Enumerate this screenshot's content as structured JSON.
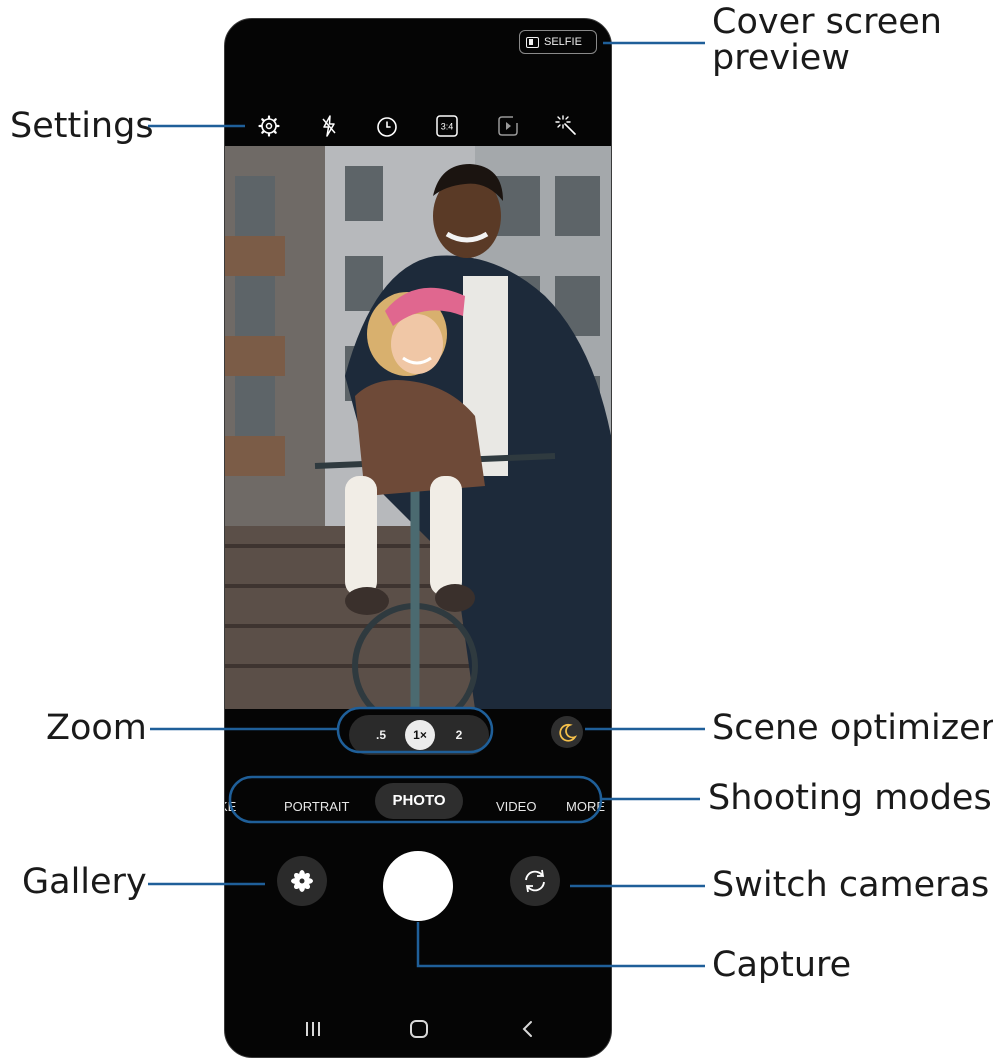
{
  "callouts": {
    "cover_screen_line1": "Cover screen",
    "cover_screen_line2": "preview",
    "settings": "Settings",
    "zoom": "Zoom",
    "scene_optimizer": "Scene optimizer",
    "shooting_modes": "Shooting modes",
    "gallery": "Gallery",
    "switch_cameras": "Switch cameras",
    "capture": "Capture"
  },
  "camera": {
    "selfie_label": "SELFIE",
    "top_icons": [
      "settings-icon",
      "flash-off-icon",
      "timer-icon",
      "aspect-ratio-icon",
      "motion-photo-icon",
      "filters-icon"
    ],
    "aspect_ratio_label": "3:4",
    "zoom": {
      "options": [
        ".5",
        "1×",
        "2"
      ],
      "selected": "1×"
    },
    "modes": [
      "KE",
      "PORTRAIT",
      "PHOTO",
      "VIDEO",
      "MORE"
    ],
    "active_mode": "PHOTO"
  },
  "colors": {
    "callout_line": "#1f5f99",
    "screen_bg": "#050505",
    "scene_moon": "#f5c04a"
  }
}
